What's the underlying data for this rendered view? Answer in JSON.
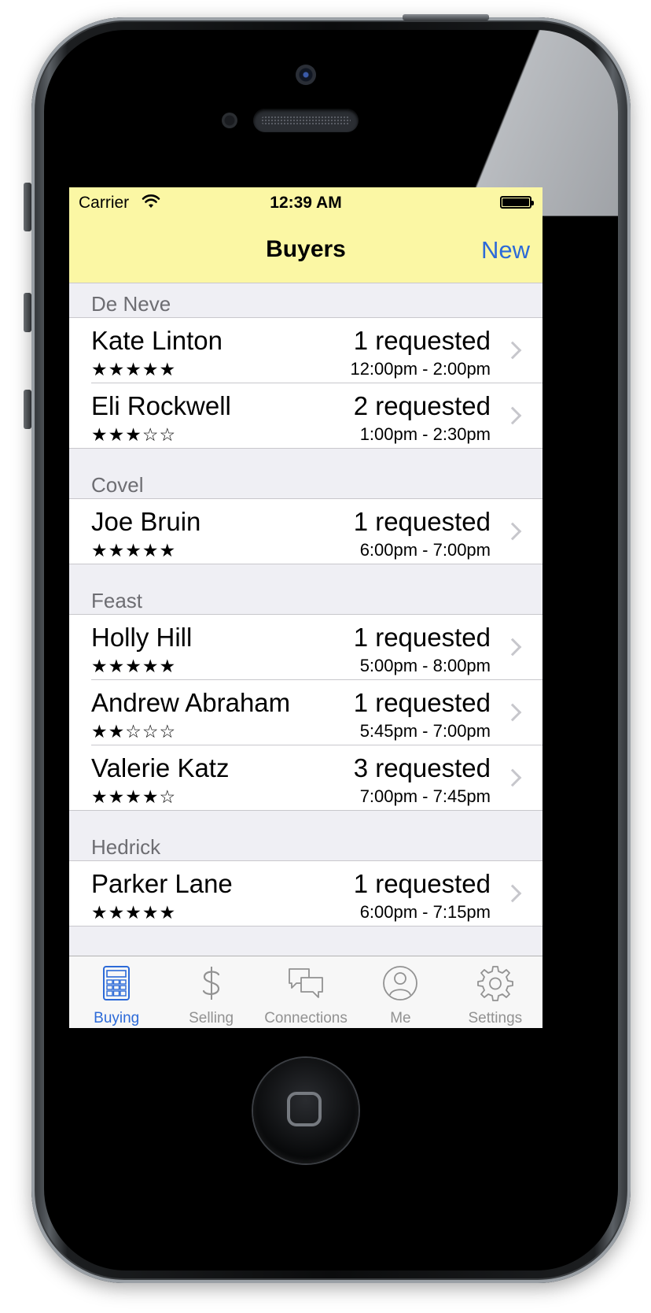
{
  "status_bar": {
    "carrier": "Carrier",
    "time": "12:39 AM"
  },
  "nav": {
    "title": "Buyers",
    "new_label": "New"
  },
  "sections": [
    {
      "header": "De Neve",
      "rows": [
        {
          "name": "Kate Linton",
          "stars": "★★★★★",
          "rating": 5,
          "requested": "1 requested",
          "window": "12:00pm - 2:00pm"
        },
        {
          "name": "Eli Rockwell",
          "stars": "★★★☆☆",
          "rating": 3,
          "requested": "2 requested",
          "window": "1:00pm - 2:30pm"
        }
      ]
    },
    {
      "header": "Covel",
      "rows": [
        {
          "name": "Joe Bruin",
          "stars": "★★★★★",
          "rating": 5,
          "requested": "1 requested",
          "window": "6:00pm - 7:00pm"
        }
      ]
    },
    {
      "header": "Feast",
      "rows": [
        {
          "name": "Holly Hill",
          "stars": "★★★★★",
          "rating": 5,
          "requested": "1 requested",
          "window": "5:00pm - 8:00pm"
        },
        {
          "name": "Andrew Abraham",
          "stars": "★★☆☆☆",
          "rating": 2,
          "requested": "1 requested",
          "window": "5:45pm - 7:00pm"
        },
        {
          "name": "Valerie Katz",
          "stars": "★★★★☆",
          "rating": 4,
          "requested": "3 requested",
          "window": "7:00pm - 7:45pm"
        }
      ]
    },
    {
      "header": "Hedrick",
      "rows": [
        {
          "name": "Parker Lane",
          "stars": "★★★★★",
          "rating": 5,
          "requested": "1 requested",
          "window": "6:00pm - 7:15pm"
        }
      ]
    }
  ],
  "tabs": [
    {
      "label": "Buying",
      "icon": "calculator-icon",
      "active": true
    },
    {
      "label": "Selling",
      "icon": "dollar-icon",
      "active": false
    },
    {
      "label": "Connections",
      "icon": "chat-bubbles-icon",
      "active": false
    },
    {
      "label": "Me",
      "icon": "person-icon",
      "active": false
    },
    {
      "label": "Settings",
      "icon": "gear-icon",
      "active": false
    }
  ],
  "colors": {
    "navbar": "#fbf7a4",
    "accent": "#2c6ad8",
    "tab_inactive": "#929292",
    "grouped_bg": "#efeff4"
  }
}
